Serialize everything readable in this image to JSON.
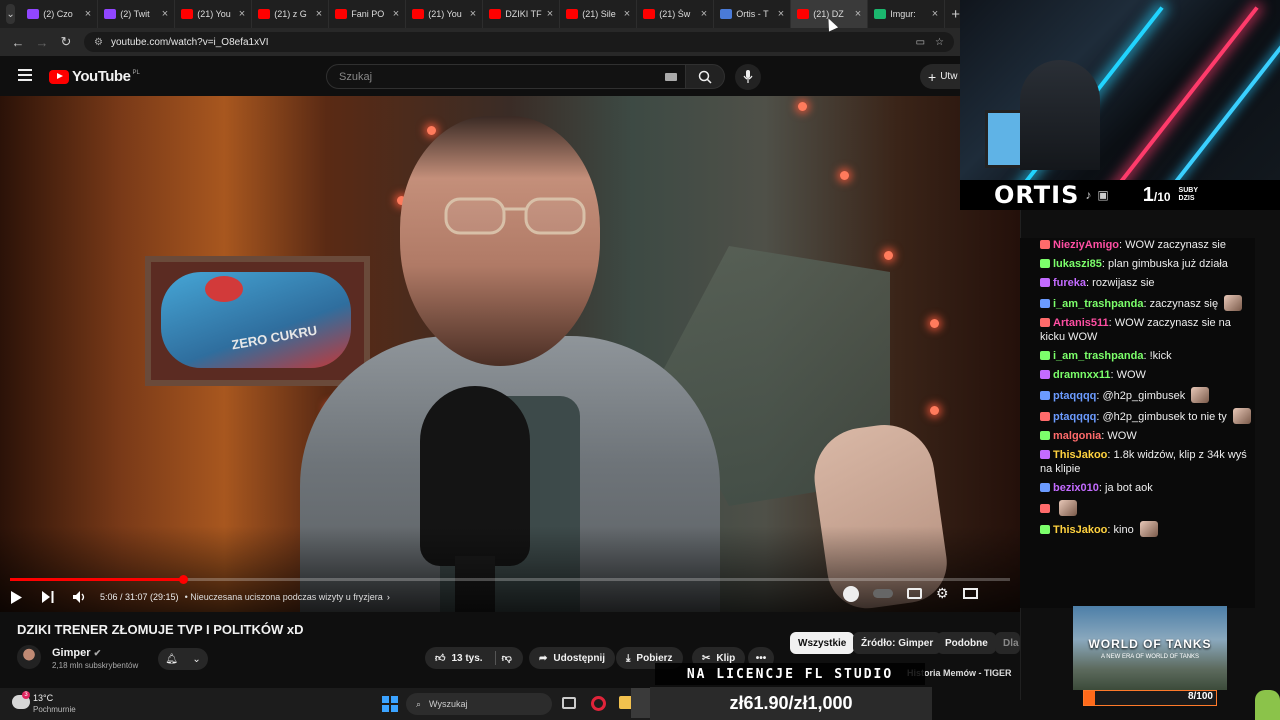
{
  "browser": {
    "tabs": [
      {
        "title": "(2) Czo",
        "color": "#9146ff",
        "active": false
      },
      {
        "title": "(2) Twit",
        "color": "#9146ff",
        "active": false
      },
      {
        "title": "(21) You",
        "color": "#ff0000",
        "active": false
      },
      {
        "title": "(21) z G",
        "color": "#ff0000",
        "active": false
      },
      {
        "title": "Fani PO",
        "color": "#ff0000",
        "active": false
      },
      {
        "title": "(21) You",
        "color": "#ff0000",
        "active": false
      },
      {
        "title": "DZIKI TF",
        "color": "#ff0000",
        "active": false
      },
      {
        "title": "(21) Sile",
        "color": "#ff0000",
        "active": false
      },
      {
        "title": "(21) Św",
        "color": "#ff0000",
        "active": false
      },
      {
        "title": "Ortis - T",
        "color": "#4a7bd8",
        "active": false
      },
      {
        "title": "(21) DZ",
        "color": "#ff0000",
        "active": true
      },
      {
        "title": "Imgur:",
        "color": "#1bb76e",
        "active": false
      }
    ],
    "close_glyph": "×",
    "new_tab_glyph": "+",
    "url": "youtube.com/watch?v=i_O8efa1xVI"
  },
  "youtube": {
    "logo_text": "YouTube",
    "logo_country": "PL",
    "search_placeholder": "Szukaj",
    "create_label": "Utw"
  },
  "player": {
    "timecode": "5:06 / 31:07 (29:15)",
    "chapter": "• Nieuczesana uciszona podczas wizyty u fryzjera",
    "progress_fraction": 0.173
  },
  "video_info": {
    "title": "DZIKI TRENER ZŁOMUJE TVP I POLITKÓW xD",
    "channel": "Gimper",
    "subscribers": "2,18 mln subskrybentów",
    "likes": "13 tys.",
    "share": "Udostępnij",
    "download": "Pobierz",
    "clip": "Klip",
    "more": "•••"
  },
  "chips": {
    "all": "Wszystkie",
    "source": "Źródło: Gimper",
    "similar": "Podobne",
    "cut": "Dla"
  },
  "recommended": {
    "title": "Historia Memów - TIGER"
  },
  "stream": {
    "nick": "ORTIS",
    "subs_count": "1",
    "subs_goal": "/10",
    "subs_label_1": "SUBY",
    "subs_label_2": "DZIS",
    "licence": "NA LICENCJE FL STUDIO",
    "donation": "zł61.90/zł1,000",
    "goal": "8/100",
    "goal_fraction": 0.08,
    "game_ad_title": "WORLD OF TANKS",
    "game_ad_sub": "A NEW ERA OF WORLD OF TANKS"
  },
  "chat": [
    {
      "user": "NieziyAmigo",
      "color": "#ff4fa3",
      "text": "WOW zaczynasz sie",
      "emote": false
    },
    {
      "user": "lukaszi85",
      "color": "#7cff6b",
      "text": "plan gimbuska już działa",
      "emote": false
    },
    {
      "user": "fureka",
      "color": "#c36bff",
      "text": "rozwijasz sie",
      "emote": false
    },
    {
      "user": "i_am_trashpanda",
      "color": "#7cff6b",
      "text": "zaczynasz się",
      "emote": true
    },
    {
      "user": "Artanis511",
      "color": "#ff4fa3",
      "text": "WOW zaczynasz sie na kicku WOW",
      "emote": false
    },
    {
      "user": "i_am_trashpanda",
      "color": "#7cff6b",
      "text": "!kick",
      "emote": false
    },
    {
      "user": "dramnxx11",
      "color": "#7cff6b",
      "text": "WOW",
      "emote": false
    },
    {
      "user": "ptaqqqq",
      "color": "#6b9bff",
      "text": "@h2p_gimbusek",
      "emote": true
    },
    {
      "user": "ptaqqqq",
      "color": "#6b9bff",
      "text": "@h2p_gimbusek to nie ty",
      "emote": true
    },
    {
      "user": "malgonia",
      "color": "#ff6b6b",
      "text": "WOW",
      "emote": false
    },
    {
      "user": "ThisJakoo",
      "color": "#ffd23f",
      "text": "1.8k widzów, klip z 34k wyś na klipie",
      "emote": false
    },
    {
      "user": "bezix010",
      "color": "#c36bff",
      "text": "ja bot aok",
      "emote": false
    },
    {
      "user": "",
      "color": "#ffffff",
      "text": "",
      "emote": true
    },
    {
      "user": "ThisJakoo",
      "color": "#ffd23f",
      "text": "kino",
      "emote": true
    }
  ],
  "taskbar": {
    "temperature": "13°C",
    "condition": "Pochmurnie",
    "badge": "3",
    "search": "Wyszukaj"
  }
}
